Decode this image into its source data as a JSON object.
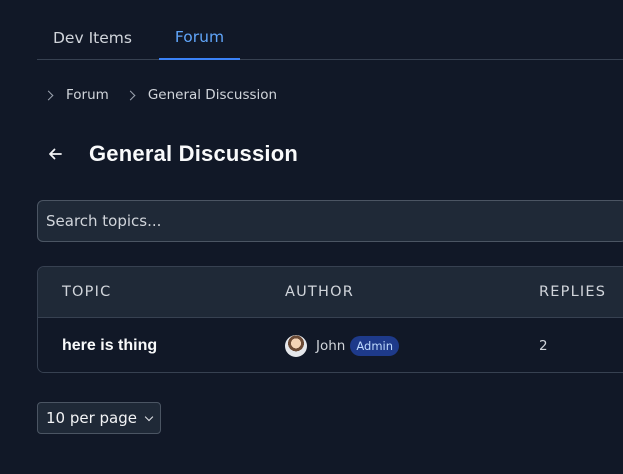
{
  "tabs": [
    {
      "label": "Dev Items",
      "active": false
    },
    {
      "label": "Forum",
      "active": true
    }
  ],
  "breadcrumb": [
    "Forum",
    "General Discussion"
  ],
  "page": {
    "title": "General Discussion",
    "back_icon": "arrow-left-icon"
  },
  "search": {
    "placeholder": "Search topics...",
    "value": ""
  },
  "table": {
    "headers": [
      "TOPIC",
      "AUTHOR",
      "REPLIES"
    ],
    "rows": [
      {
        "topic": "here is thing",
        "author": "John",
        "badge": "Admin",
        "replies": "2"
      }
    ]
  },
  "pagination": {
    "per_page": "10 per page"
  },
  "colors": {
    "background": "#111827",
    "accent": "#3b82f6",
    "badge_bg": "#1e3a8a"
  }
}
